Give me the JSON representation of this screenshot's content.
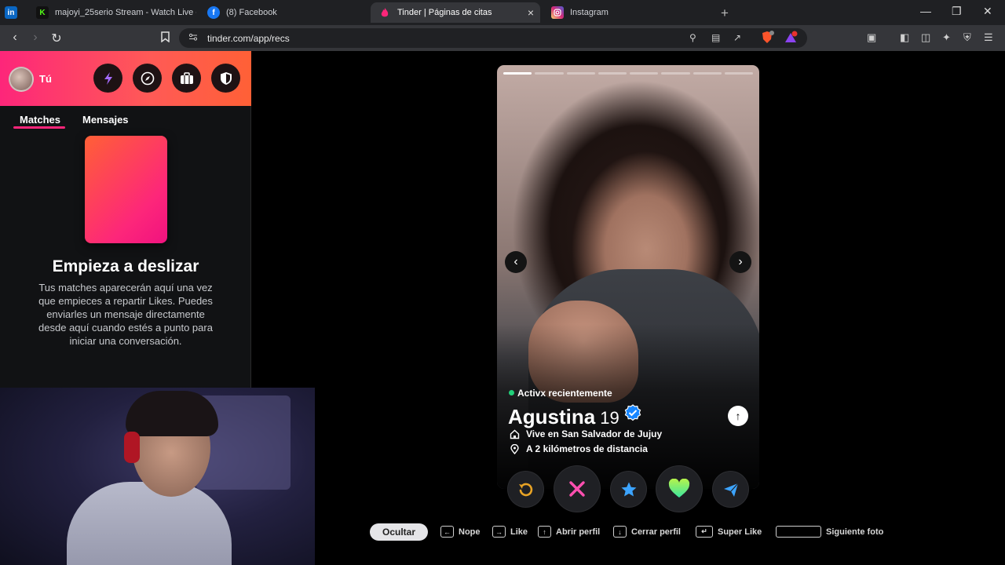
{
  "browser": {
    "tabs": [
      {
        "icon": "linkedin-icon",
        "icon_text": "in",
        "icon_color": "#0a66c2",
        "title": ""
      },
      {
        "icon": "kick-icon",
        "icon_text": "K",
        "icon_color": "#53fc18",
        "title": "majoyi_25serio Stream - Watch Live o"
      },
      {
        "icon": "facebook-icon",
        "icon_text": "f",
        "icon_color": "#1877f2",
        "title": "(8) Facebook"
      },
      {
        "icon": "tinder-icon",
        "icon_text": "",
        "icon_color": "#fd267a",
        "title": "Tinder | Páginas de citas",
        "close": "×"
      },
      {
        "icon": "instagram-icon",
        "icon_text": "",
        "icon_color": "#d62976",
        "title": "Instagram"
      }
    ],
    "new_tab": "+",
    "window_controls": {
      "minimize": "—",
      "restore": "❐",
      "close": "✕"
    },
    "url": "tinder.com/app/recs",
    "brave_badge": "4",
    "rewards_badge": "1"
  },
  "sidebar": {
    "user_label": "Tú",
    "header_buttons": [
      "boost-icon",
      "explore-icon",
      "briefcase-icon",
      "shield-icon"
    ],
    "tabs": [
      "Matches",
      "Mensajes"
    ],
    "empty_title": "Empieza a deslizar",
    "empty_desc": "Tus matches aparecerán aquí una vez que empieces a repartir Likes. Puedes enviarles un mensaje directamente desde aquí cuando estés a punto para iniciar una conversación."
  },
  "profile": {
    "photo_count": 8,
    "current_photo": 1,
    "status": "Activx recientemente",
    "name": "Agustina",
    "age": "19",
    "verified": true,
    "lives_in": "Vive en San Salvador de Jujuy",
    "distance": "A 2 kilómetros de distancia"
  },
  "actions": [
    {
      "name": "rewind-button",
      "icon": "rewind-icon",
      "color": "#e8a325"
    },
    {
      "name": "nope-button",
      "icon": "close-icon",
      "color": "#ff4458"
    },
    {
      "name": "super-like-button",
      "icon": "star-icon",
      "color": "#3ca4ff"
    },
    {
      "name": "like-button",
      "icon": "heart-icon",
      "color": "#3be6a0"
    },
    {
      "name": "boost-button",
      "icon": "send-icon",
      "color": "#3ca4ff"
    }
  ],
  "hints": {
    "hide": "Ocultar",
    "nope": "Nope",
    "like": "Like",
    "open_profile": "Abrir perfil",
    "close_profile": "Cerrar perfil",
    "super_like": "Super Like",
    "next_photo": "Siguiente foto"
  },
  "colors": {
    "brand_pink": "#fd267a",
    "brand_orange": "#ff6036",
    "online_green": "#21d07a",
    "verified_blue": "#1786ff"
  }
}
